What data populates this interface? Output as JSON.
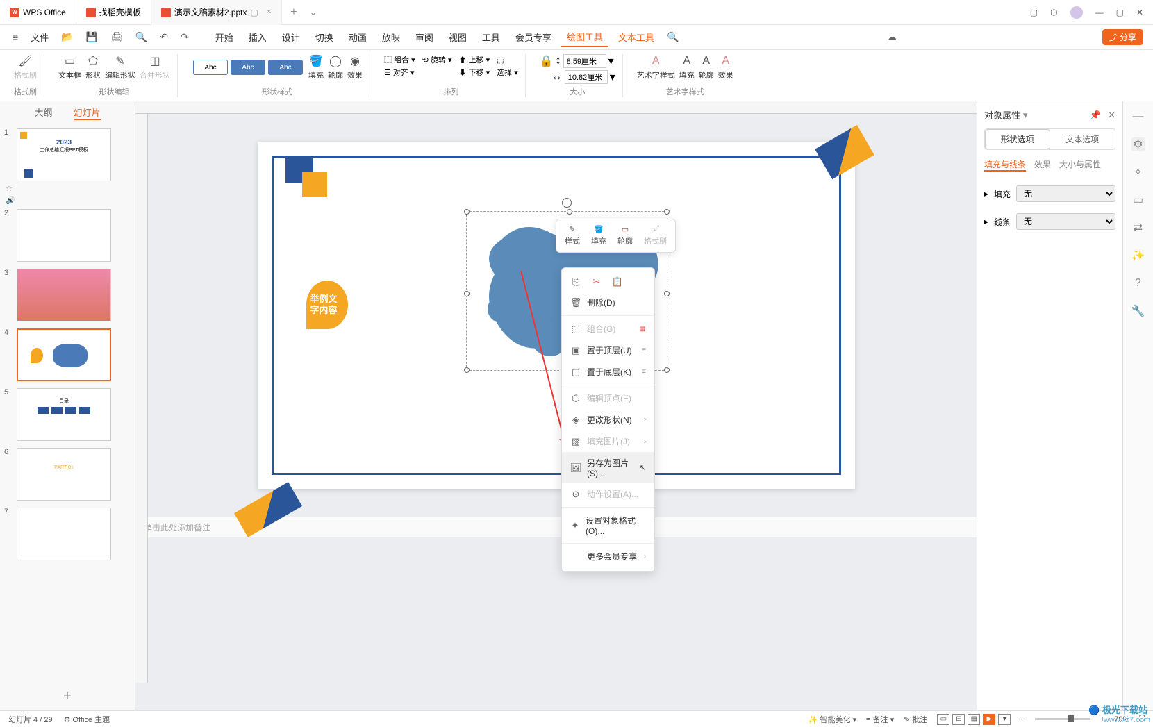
{
  "titlebar": {
    "tabs": [
      {
        "icon": "wps",
        "label": "WPS Office"
      },
      {
        "icon": "docer",
        "label": "找稻壳模板"
      },
      {
        "icon": "ppt",
        "label": "演示文稿素材2.pptx",
        "active": true
      }
    ]
  },
  "menubar": {
    "file": "文件",
    "items": [
      "开始",
      "插入",
      "设计",
      "切换",
      "动画",
      "放映",
      "审阅",
      "视图",
      "工具",
      "会员专享",
      "绘图工具",
      "文本工具"
    ],
    "active_indices": [
      10
    ],
    "share": "分享"
  },
  "ribbon": {
    "groups": [
      {
        "label": "格式刷",
        "btns": [
          {
            "t": "格式刷",
            "dis": true
          }
        ]
      },
      {
        "label": "形状编辑",
        "btns": [
          {
            "t": "文本框"
          },
          {
            "t": "形状"
          },
          {
            "t": "编辑形状"
          },
          {
            "t": "合并形状",
            "dis": true
          }
        ]
      },
      {
        "label": "形状样式",
        "presets": [
          "Abc",
          "Abc",
          "Abc"
        ],
        "btns": [
          {
            "t": "填充"
          },
          {
            "t": "轮廓"
          },
          {
            "t": "效果"
          }
        ]
      },
      {
        "label": "排列",
        "btns": [
          {
            "t": "组合"
          },
          {
            "t": "旋转"
          },
          {
            "t": "上移"
          },
          {
            "t": "对齐"
          },
          {
            "t": "下移"
          },
          {
            "t": "选择"
          }
        ]
      },
      {
        "label": "大小",
        "width": "8.59厘米",
        "height": "10.82厘米"
      },
      {
        "label": "艺术字样式",
        "btns": [
          {
            "t": "艺术字样式"
          },
          {
            "t": "填充"
          },
          {
            "t": "轮廓"
          },
          {
            "t": "效果"
          }
        ]
      }
    ]
  },
  "slide_panel": {
    "outline": "大纲",
    "slides": "幻灯片",
    "count": 7,
    "active": 4
  },
  "slide_content": {
    "badge": "举例文字内容"
  },
  "floating_toolbar": {
    "items": [
      {
        "t": "样式"
      },
      {
        "t": "填充"
      },
      {
        "t": "轮廓"
      },
      {
        "t": "格式刷",
        "dis": true
      }
    ]
  },
  "context_menu": {
    "top_icons": [
      "copy",
      "cut",
      "paste"
    ],
    "items": [
      {
        "t": "删除(D)",
        "icon": "🗑"
      },
      {
        "sep": true
      },
      {
        "t": "组合(G)",
        "icon": "⬚",
        "dis": true,
        "icon2": "▦"
      },
      {
        "t": "置于顶层(U)",
        "icon": "▣",
        "icon2": "≡"
      },
      {
        "t": "置于底层(K)",
        "icon": "▢",
        "icon2": "≡"
      },
      {
        "sep": true
      },
      {
        "t": "编辑顶点(E)",
        "icon": "⬡",
        "dis": true
      },
      {
        "t": "更改形状(N)",
        "icon": "◈",
        "arrow": true
      },
      {
        "t": "填充图片(J)",
        "icon": "▨",
        "dis": true,
        "arrow": true
      },
      {
        "t": "另存为图片(S)...",
        "icon": "🖼",
        "hover": true
      },
      {
        "t": "动作设置(A)...",
        "icon": "⊙",
        "dis": true
      },
      {
        "sep": true
      },
      {
        "t": "设置对象格式(O)...",
        "icon": "✦"
      },
      {
        "sep": true
      },
      {
        "t": "更多会员专享",
        "arrow": true
      }
    ]
  },
  "panel": {
    "title": "对象属性",
    "tab_shape": "形状选项",
    "tab_text": "文本选项",
    "subtabs": [
      "填充与线条",
      "效果",
      "大小与属性"
    ],
    "fill_label": "填充",
    "fill_value": "无",
    "line_label": "线条",
    "line_value": "无"
  },
  "notes": "单击此处添加备注",
  "statusbar": {
    "slide_info": "幻灯片 4 / 29",
    "theme": "Office 主题",
    "beautify": "智能美化",
    "notes_btn": "备注",
    "comments": "批注",
    "zoom": "79%"
  },
  "watermark": {
    "site": "极光下载站",
    "url": "www.xz7.com"
  }
}
